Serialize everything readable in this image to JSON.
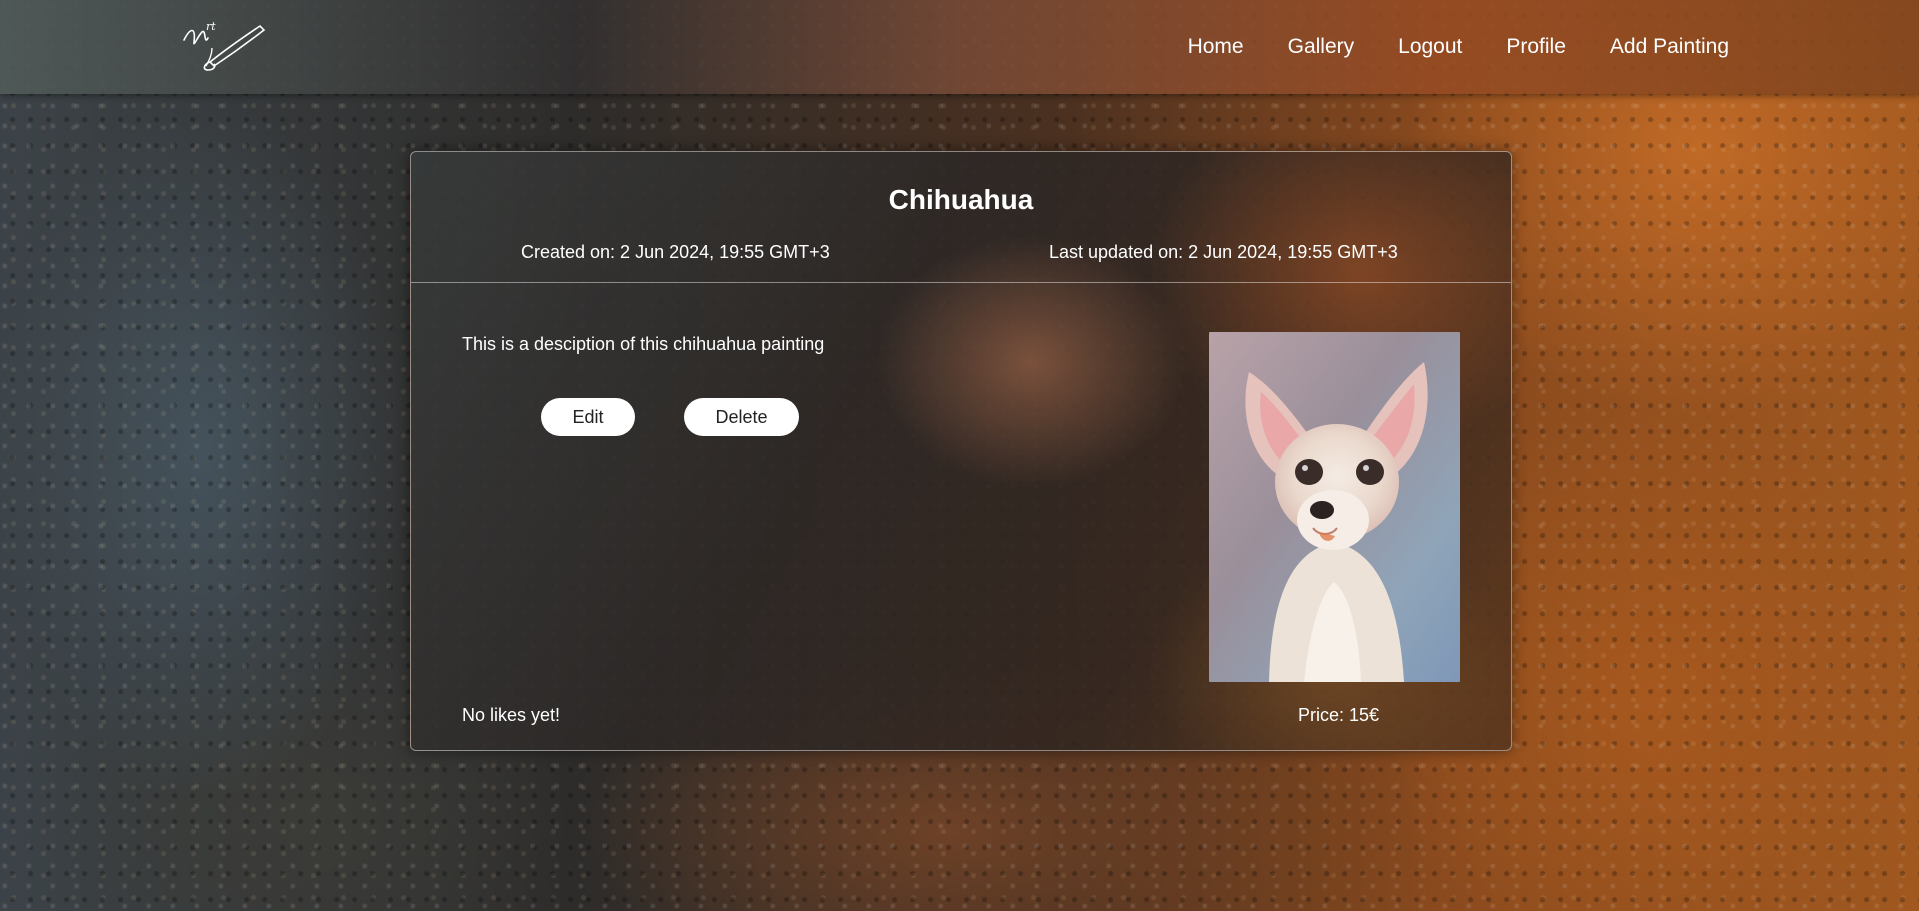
{
  "nav": {
    "logo_alt": "Art",
    "items": [
      {
        "label": "Home"
      },
      {
        "label": "Gallery"
      },
      {
        "label": "Logout"
      },
      {
        "label": "Profile"
      },
      {
        "label": "Add Painting"
      }
    ]
  },
  "painting": {
    "title": "Chihuahua",
    "created": "Created on: 2 Jun 2024, 19:55 GMT+3",
    "updated": "Last updated on: 2 Jun 2024, 19:55 GMT+3",
    "description": "This is a desciption of this chihuahua painting",
    "image_subject": "chihuahua-painting",
    "likes_text": "No likes yet!",
    "price_text": "Price: 15€"
  },
  "actions": {
    "edit_label": "Edit",
    "delete_label": "Delete"
  },
  "colors": {
    "button_bg": "#ffffff",
    "button_text": "#222222",
    "text": "#ffffff"
  }
}
